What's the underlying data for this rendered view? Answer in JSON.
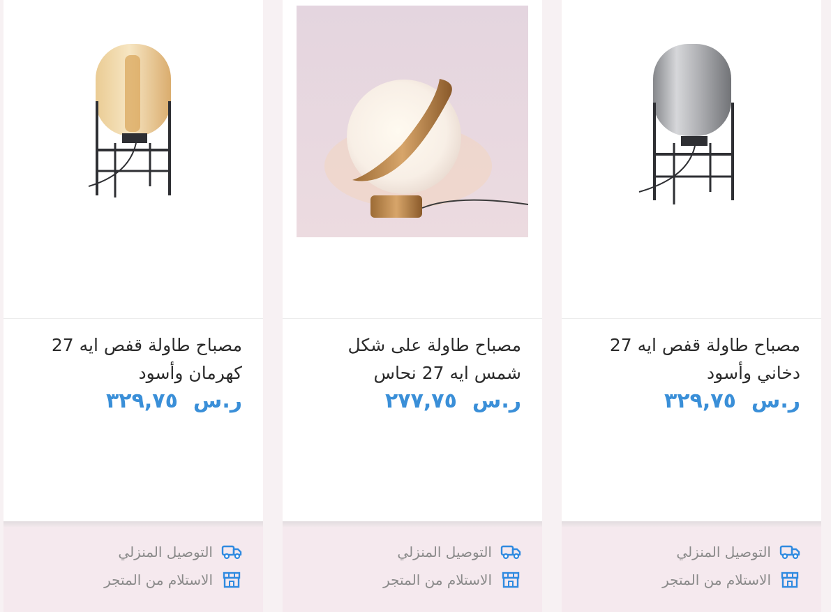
{
  "products": [
    {
      "title_line1": "مصباح طاولة قفص ايه 27",
      "title_line2": "كهرمان وأسود",
      "currency": "ر.س",
      "price": "٣٢٩,٧٥",
      "image_icon": "amber-cage-lamp-image"
    },
    {
      "title_line1": "مصباح طاولة على شكل",
      "title_line2": "شمس ايه 27 نحاس",
      "currency": "ر.س",
      "price": "٢٧٧,٧٥",
      "image_icon": "sphere-lamp-image"
    },
    {
      "title_line1": "مصباح طاولة قفص ايه 27",
      "title_line2": "دخاني وأسود",
      "currency": "ر.س",
      "price": "٣٢٩,٧٥",
      "image_icon": "smoke-cage-lamp-image"
    }
  ],
  "fulfillment": {
    "delivery_label": "التوصيل المنزلي",
    "pickup_label": "الاستلام من المتجر"
  },
  "colors": {
    "price": "#3a8fd8",
    "icon": "#2f8ae0",
    "bottom_bg": "#f5e9ee"
  }
}
